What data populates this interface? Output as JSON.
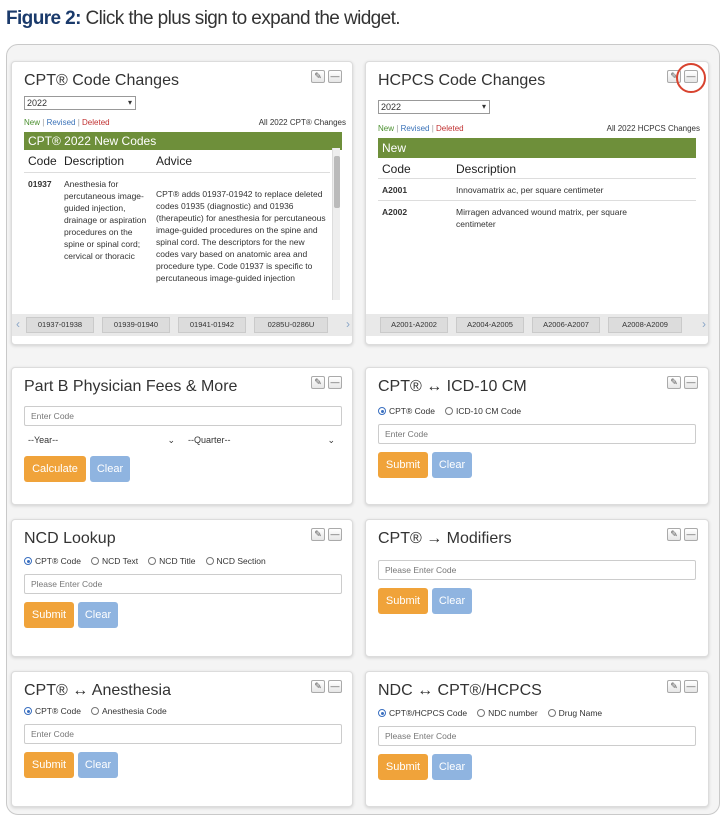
{
  "caption": {
    "label": "Figure 2:",
    "text": " Click the plus sign to expand the widget."
  },
  "cpt_changes": {
    "title": "CPT® Code Changes",
    "year": "2022",
    "legend": {
      "new": "New",
      "revised": "Revised",
      "deleted": "Deleted",
      "sep": "|"
    },
    "all_link": "All 2022 CPT® Changes",
    "banner": "CPT® 2022 New Codes",
    "headers": {
      "code": "Code",
      "description": "Description",
      "advice": "Advice"
    },
    "row": {
      "code": "01937",
      "description": "Anesthesia for percutaneous image-guided injection, drainage or aspiration procedures on the spine or spinal cord; cervical or thoracic",
      "advice": "CPT® adds 01937-01942 to replace deleted codes 01935 (diagnostic) and 01936 (therapeutic) for anesthesia for percutaneous image-guided procedures on the spine and spinal cord. The descriptors for the new codes vary based on anatomic area and procedure type. Code 01937 is specific to percutaneous image-guided injection"
    },
    "ranges": [
      "01937-01938",
      "01939-01940",
      "01941-01942",
      "0285U-0286U"
    ]
  },
  "hcpcs_changes": {
    "title": "HCPCS Code Changes",
    "year": "2022",
    "legend": {
      "new": "New",
      "revised": "Revised",
      "deleted": "Deleted",
      "sep": "|"
    },
    "all_link": "All 2022 HCPCS Changes",
    "banner": "New",
    "headers": {
      "code": "Code",
      "description": "Description"
    },
    "rows": [
      {
        "code": "A2001",
        "description": "Innovamatrix ac, per square centimeter"
      },
      {
        "code": "A2002",
        "description": "Mirragen advanced wound matrix, per square centimeter"
      }
    ],
    "ranges": [
      "A2001-A2002",
      "A2004-A2005",
      "A2006-A2007",
      "A2008-A2009"
    ]
  },
  "part_b": {
    "title": "Part B Physician Fees & More",
    "code_placeholder": "Enter Code",
    "year_select": "--Year--",
    "quarter_select": "--Quarter--",
    "calculate": "Calculate",
    "clear": "Clear"
  },
  "cpt_icd": {
    "title": "CPT® ↔ ICD-10 CM",
    "options": [
      "CPT® Code",
      "ICD-10 CM Code"
    ],
    "placeholder": "Enter Code",
    "submit": "Submit",
    "clear": "Clear"
  },
  "ncd": {
    "title": "NCD Lookup",
    "options": [
      "CPT® Code",
      "NCD Text",
      "NCD Title",
      "NCD Section"
    ],
    "placeholder": "Please Enter Code",
    "submit": "Submit",
    "clear": "Clear"
  },
  "cpt_modifiers": {
    "title": "CPT® → Modifiers",
    "placeholder": "Please Enter Code",
    "submit": "Submit",
    "clear": "Clear"
  },
  "cpt_anesthesia": {
    "title": "CPT® ↔ Anesthesia",
    "options": [
      "CPT® Code",
      "Anesthesia Code"
    ],
    "placeholder": "Enter Code",
    "submit": "Submit",
    "clear": "Clear"
  },
  "ndc": {
    "title": "NDC ↔ CPT®/HCPCS",
    "options": [
      "CPT®/HCPCS Code",
      "NDC number",
      "Drug Name"
    ],
    "placeholder": "Please Enter Code",
    "submit": "Submit",
    "clear": "Clear"
  },
  "controls": {
    "pin": "📌",
    "minimize": "—",
    "chevron": "⌄",
    "left_arrow": "‹",
    "right_arrow": "›"
  },
  "colors": {
    "accent_orange": "#f0a33a",
    "clear_blue": "#8fb4e0",
    "banner_green": "#6e8f3a",
    "highlight_red": "#d8432f"
  }
}
